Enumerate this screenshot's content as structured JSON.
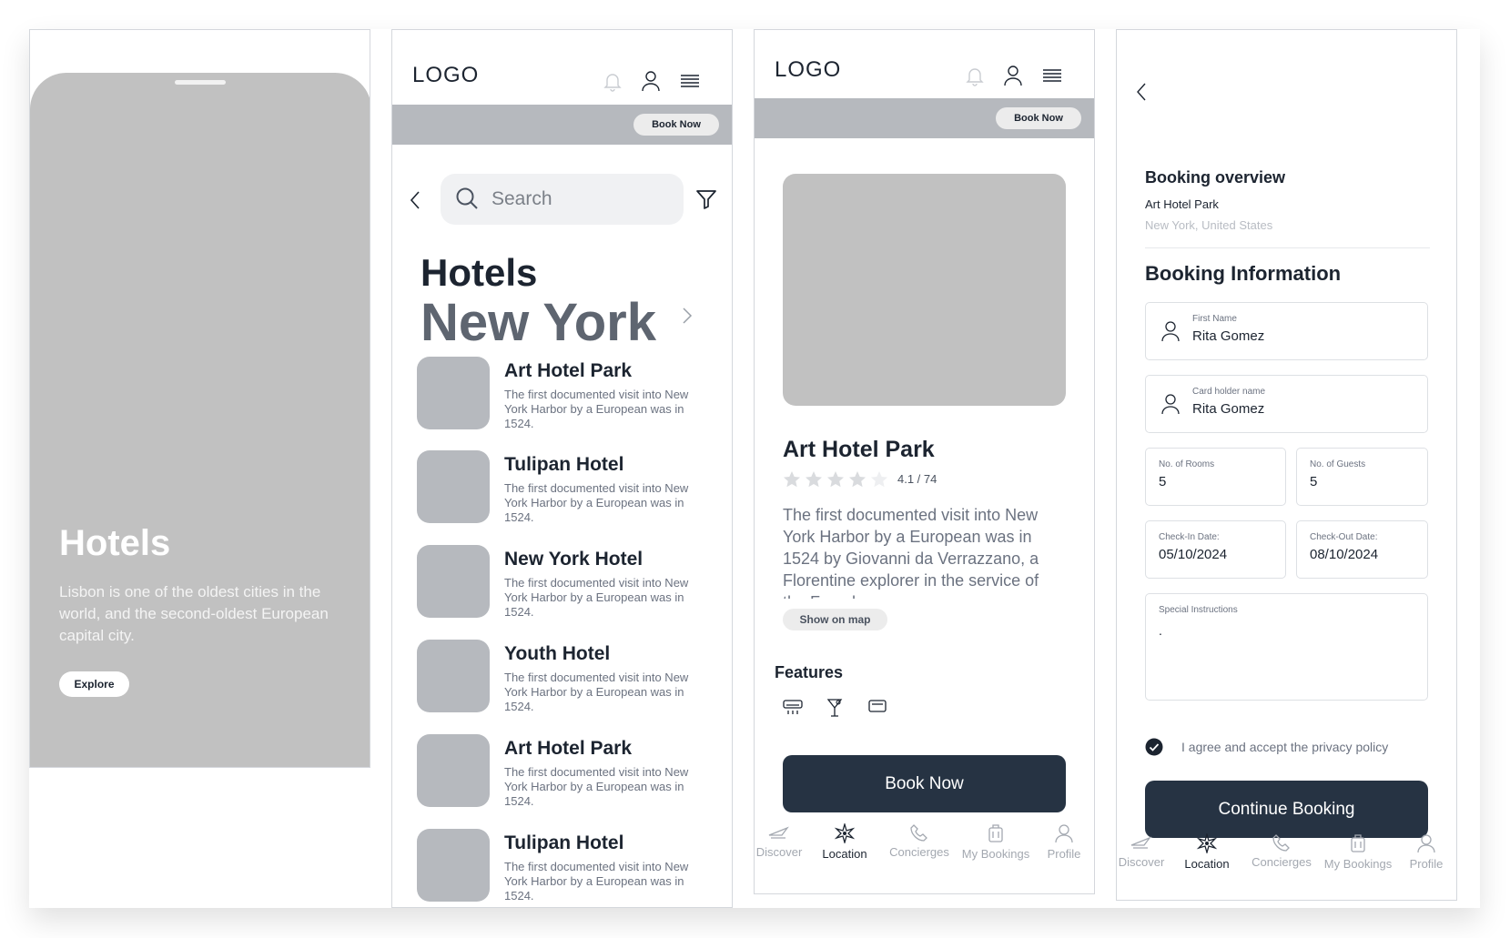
{
  "splash": {
    "title": "Hotels",
    "description": "Lisbon is one of the oldest cities in the world, and the second-oldest European capital city.",
    "explore_label": "Explore"
  },
  "header": {
    "logo": "LOGO",
    "book_now_label": "Book Now"
  },
  "list_screen": {
    "search_placeholder": "Search",
    "heading": "Hotels",
    "city": "New York",
    "items": [
      {
        "name": "Art Hotel Park",
        "description": "The first documented visit into New York Harbor by a European was in 1524."
      },
      {
        "name": "Tulipan Hotel",
        "description": "The first documented visit into New York Harbor by a European was in 1524."
      },
      {
        "name": "New York Hotel",
        "description": "The first documented visit into New York Harbor by a European was in 1524."
      },
      {
        "name": "Youth Hotel",
        "description": "The first documented visit into New York Harbor by a European was in 1524."
      },
      {
        "name": "Art Hotel Park",
        "description": "The first documented visit into New York Harbor by a European was in 1524."
      },
      {
        "name": "Tulipan Hotel",
        "description": "The first documented visit into New York Harbor by a European was in 1524."
      }
    ]
  },
  "detail_screen": {
    "title": "Art Hotel Park",
    "stars_filled": 4,
    "stars_total": 5,
    "rating_text": "4.1 / 74",
    "description": "The first documented visit into New York Harbor by a European was in 1524 by Giovanni da Verrazzano, a Florentine explorer in the service of the French crown.",
    "show_on_map_label": "Show on map",
    "features_label": "Features",
    "features": [
      "air-conditioner",
      "cocktail-bar",
      "tv"
    ],
    "book_now_label": "Book Now"
  },
  "bottom_nav": {
    "items": [
      {
        "label": "Discover",
        "icon": "plane-icon"
      },
      {
        "label": "Location",
        "icon": "compass-star-icon"
      },
      {
        "label": "Concierges",
        "icon": "phone-icon"
      },
      {
        "label": "My Bookings",
        "icon": "luggage-icon"
      },
      {
        "label": "Profile",
        "icon": "user-icon"
      }
    ],
    "active": "Location"
  },
  "booking_screen": {
    "overview_title": "Booking overview",
    "hotel_name": "Art Hotel Park",
    "location": "New York, United States",
    "info_title": "Booking Information",
    "first_name_label": "First Name",
    "first_name_value": "Rita Gomez",
    "card_holder_label": "Card holder name",
    "card_holder_value": "Rita Gomez",
    "rooms_label": "No. of Rooms",
    "rooms_value": "5",
    "guests_label": "No. of Guests",
    "guests_value": "5",
    "checkin_label": "Check-In Date:",
    "checkin_value": "05/10/2024",
    "checkout_label": "Check-Out Date:",
    "checkout_value": "08/10/2024",
    "instructions_label": "Special Instructions",
    "instructions_value": ".",
    "agree_text": "I agree and accept the privacy policy",
    "agree_checked": true,
    "continue_label": "Continue Booking"
  },
  "colors": {
    "primary_button": "#263343",
    "placeholder_gray": "#b6b9be",
    "text_dark": "#1c2430",
    "text_muted": "#6b7280"
  }
}
